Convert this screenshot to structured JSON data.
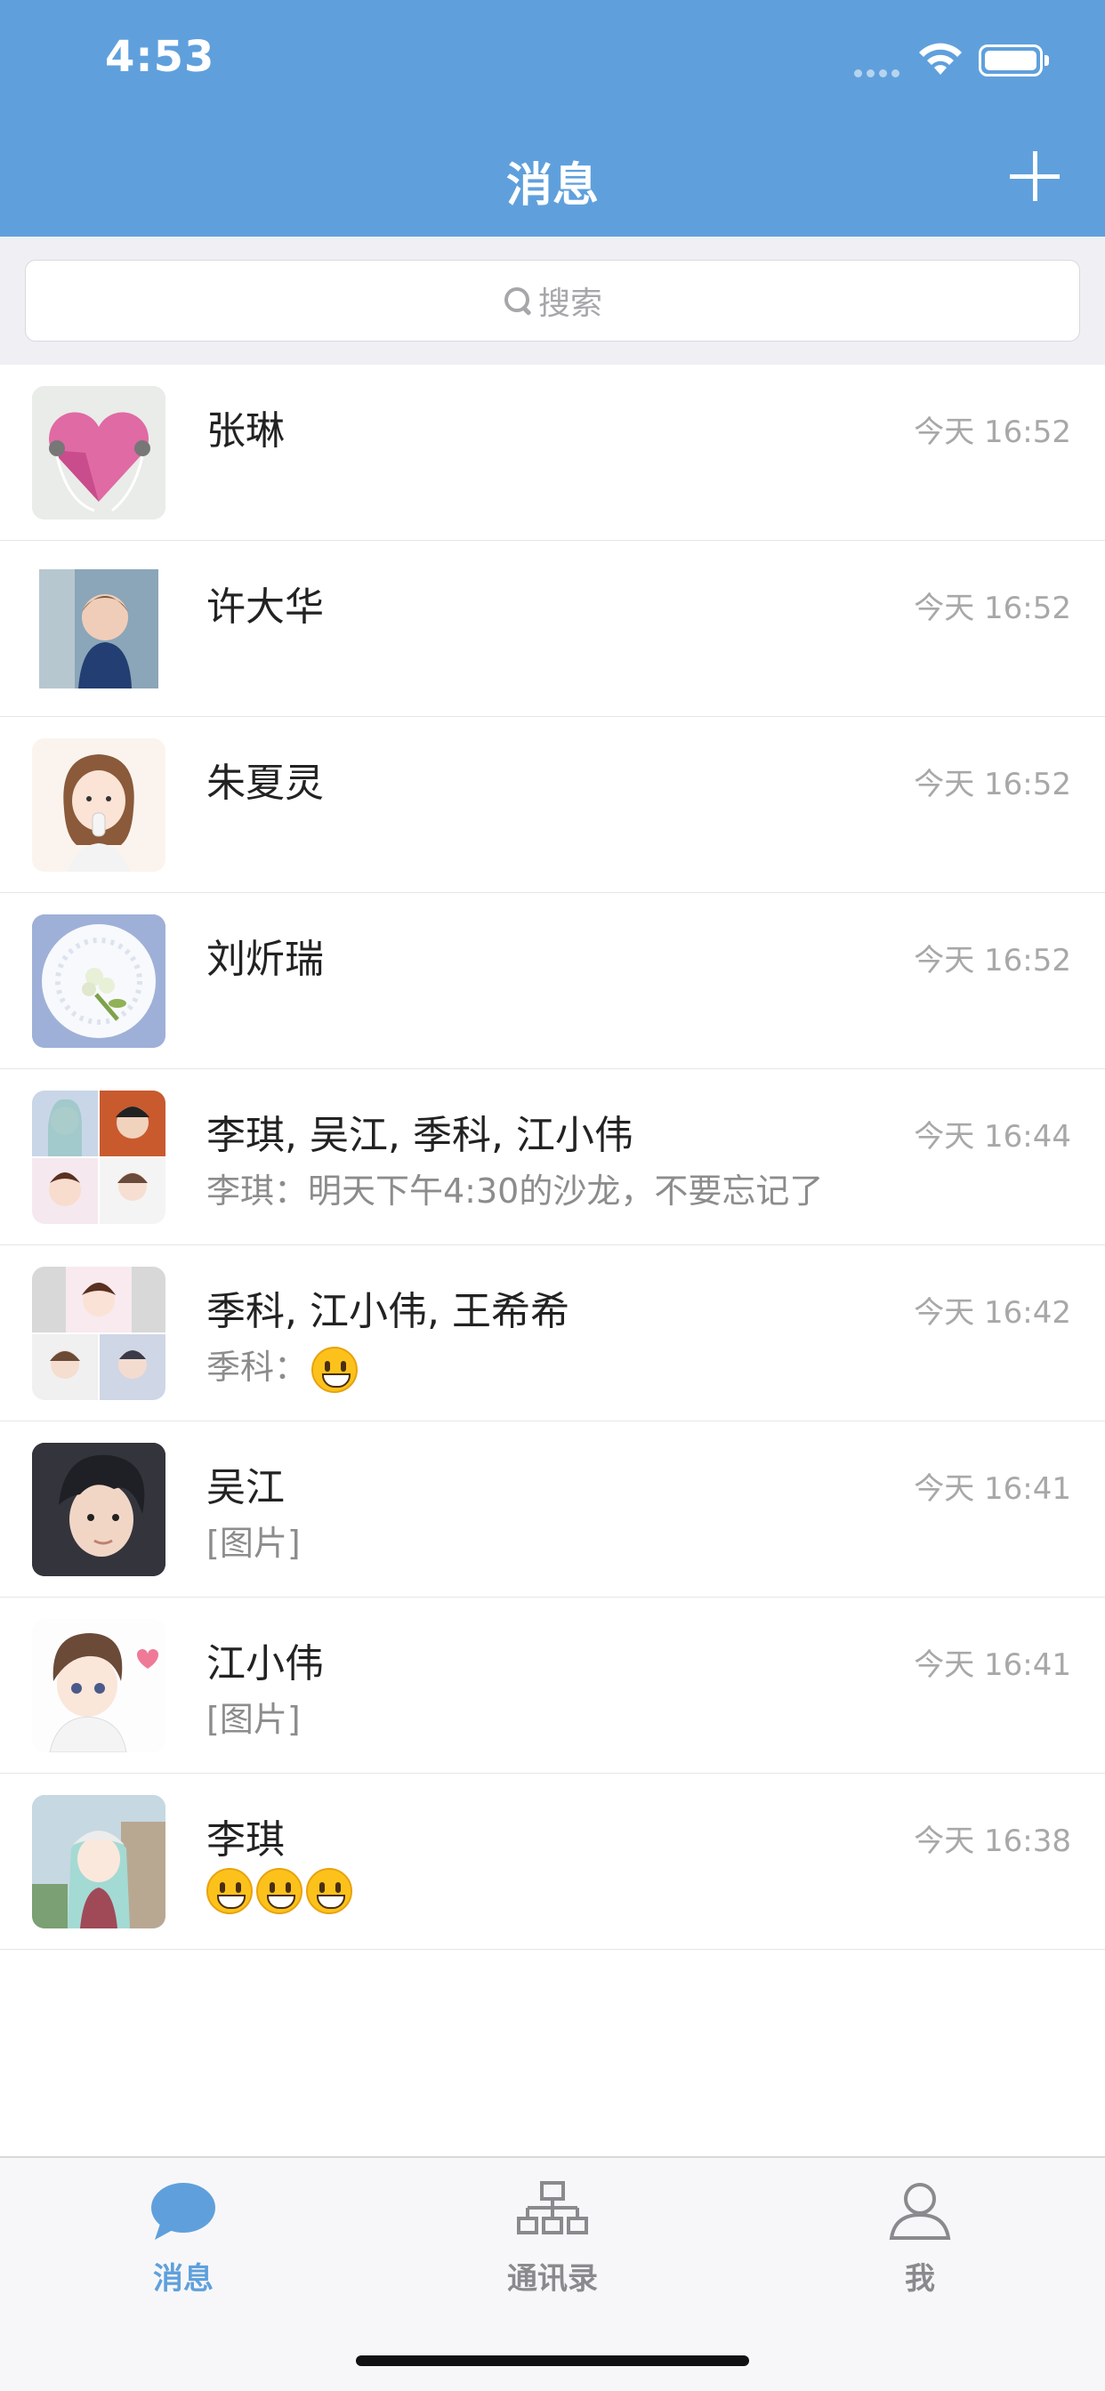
{
  "status_bar": {
    "time": "4:53"
  },
  "header": {
    "title": "消息"
  },
  "search": {
    "placeholder": "搜索"
  },
  "conversations": [
    {
      "name": "张琳",
      "time": "今天 16:52",
      "preview": "",
      "avatar": "heart-earphones-avatar"
    },
    {
      "name": "许大华",
      "time": "今天 16:52",
      "preview": "",
      "avatar": "child-photo-avatar"
    },
    {
      "name": "朱夏灵",
      "time": "今天 16:52",
      "preview": "",
      "avatar": "girl-illustration-avatar"
    },
    {
      "name": "刘炘瑞",
      "time": "今天 16:52",
      "preview": "",
      "avatar": "lace-flower-avatar"
    },
    {
      "name": "李琪, 吴江, 季科, 江小伟",
      "time": "今天 16:44",
      "preview": "李琪：明天下午4:30的沙龙，不要忘记了",
      "avatar": "group-grid-avatar"
    },
    {
      "name": "季科, 江小伟, 王希希",
      "time": "今天 16:42",
      "preview": "季科：",
      "preview_emoji": "smiley",
      "avatar": "group-grid-avatar"
    },
    {
      "name": "吴江",
      "time": "今天 16:41",
      "preview": "[图片]",
      "avatar": "boy-photo-avatar"
    },
    {
      "name": "江小伟",
      "time": "今天 16:41",
      "preview": "[图片]",
      "avatar": "anime-boy-avatar"
    },
    {
      "name": "李琪",
      "time": "今天 16:38",
      "preview": "",
      "preview_emoji": "grin x3",
      "avatar": "anime-girl-avatar"
    }
  ],
  "tabbar": {
    "tabs": [
      {
        "label": "消息",
        "icon": "chat-bubble-icon",
        "active": true
      },
      {
        "label": "通讯录",
        "icon": "org-chart-icon",
        "active": false
      },
      {
        "label": "我",
        "icon": "person-icon",
        "active": false
      }
    ]
  },
  "colors": {
    "primary": "#5fa0dc",
    "tab_inactive": "#8a8a8e"
  }
}
